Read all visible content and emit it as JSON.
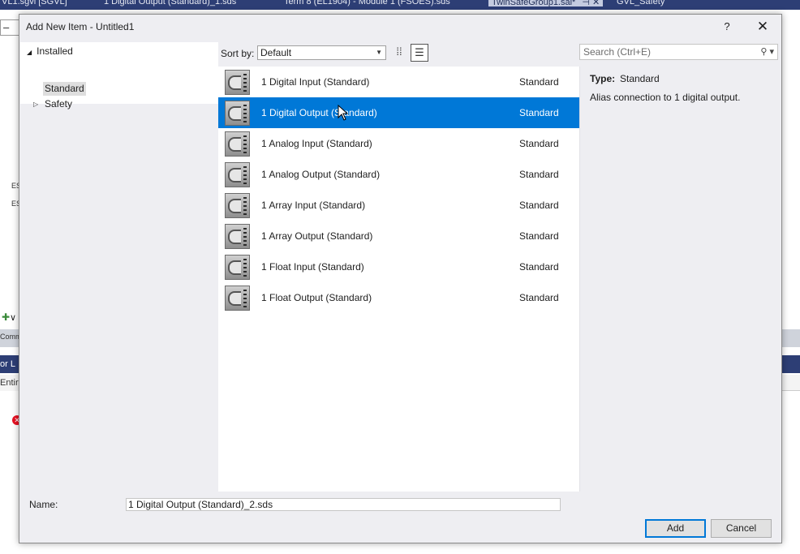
{
  "background": {
    "tabs": [
      "VL1.sgvl [SGVL]",
      "1 Digital Output (Standard)_1.sds",
      "Term 8 (EL1904) - Module 1 (FSOES).sds",
      "TwinSafeGroup1.sal*",
      "GVL_Safety"
    ],
    "left_fragments": [
      "ES",
      "ES",
      "Comma",
      "or L",
      "Entire"
    ]
  },
  "dialog": {
    "title": "Add New Item - Untitled1",
    "help_label": "?",
    "close_label": "✕"
  },
  "tree": {
    "header": "Installed",
    "items": [
      {
        "label": "Standard",
        "selected": true
      },
      {
        "label": "Safety",
        "selected": false
      }
    ]
  },
  "sort": {
    "label": "Sort by:",
    "value": "Default"
  },
  "search": {
    "placeholder": "Search (Ctrl+E)"
  },
  "templates": [
    {
      "name": "1 Digital Input (Standard)",
      "type": "Standard",
      "selected": false
    },
    {
      "name": "1 Digital Output (Standard)",
      "type": "Standard",
      "selected": true
    },
    {
      "name": "1 Analog Input (Standard)",
      "type": "Standard",
      "selected": false
    },
    {
      "name": "1 Analog Output (Standard)",
      "type": "Standard",
      "selected": false
    },
    {
      "name": "1 Array Input (Standard)",
      "type": "Standard",
      "selected": false
    },
    {
      "name": "1 Array Output (Standard)",
      "type": "Standard",
      "selected": false
    },
    {
      "name": "1 Float Input (Standard)",
      "type": "Standard",
      "selected": false
    },
    {
      "name": "1 Float Output (Standard)",
      "type": "Standard",
      "selected": false
    }
  ],
  "details": {
    "type_label": "Type:",
    "type_value": "Standard",
    "description": "Alias connection to 1 digital output."
  },
  "name_field": {
    "label": "Name:",
    "value": "1 Digital Output (Standard)_2.sds"
  },
  "buttons": {
    "add": "Add",
    "cancel": "Cancel"
  },
  "colors": {
    "selection": "#0078d7",
    "dialog_bg": "#eeeef2",
    "ide_tabbar": "#2d3e75"
  }
}
